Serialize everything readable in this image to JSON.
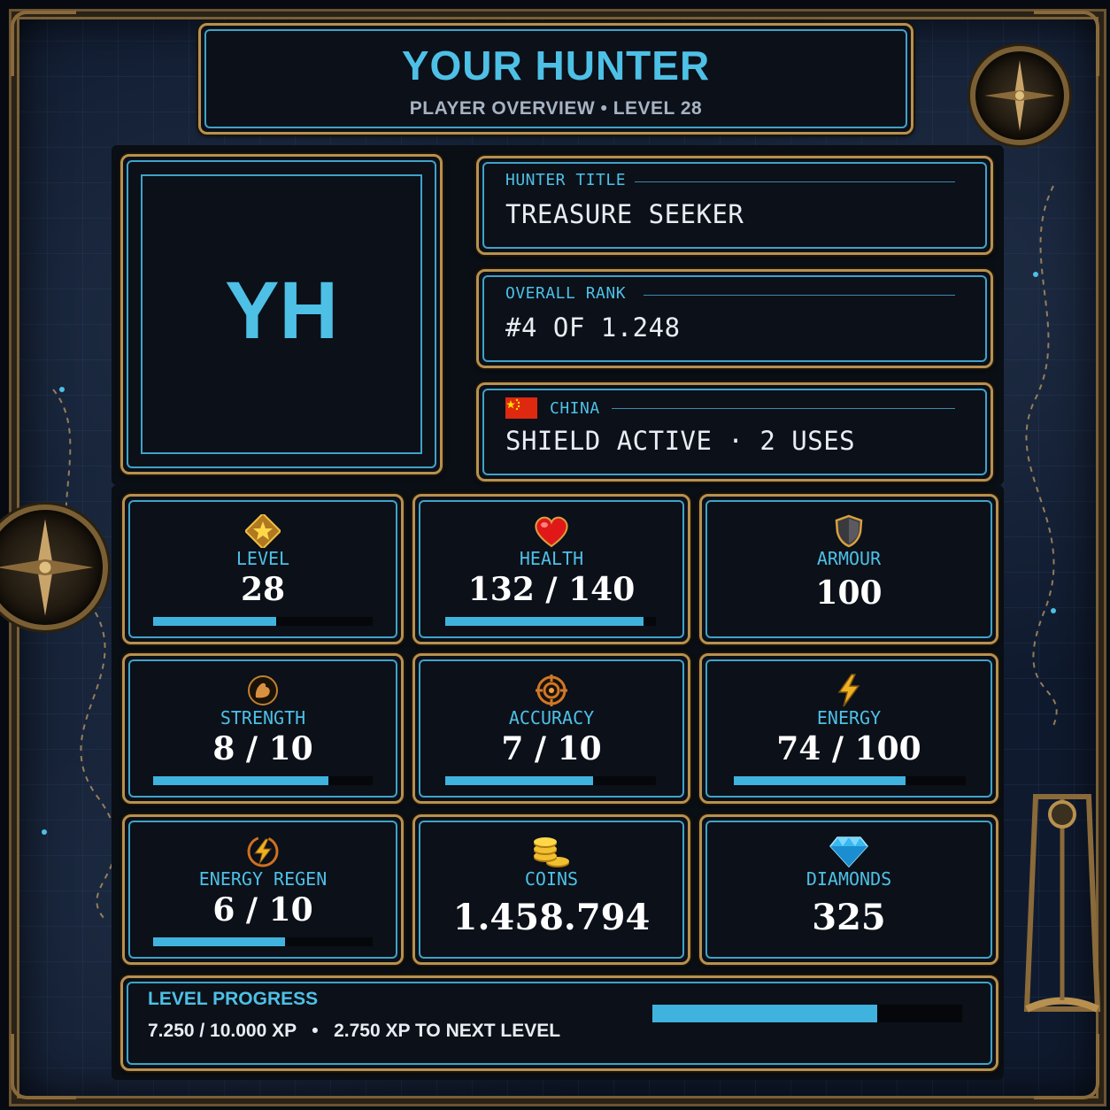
{
  "header": {
    "title": "YOUR HUNTER",
    "subtitle": "PLAYER OVERVIEW  •  LEVEL 28"
  },
  "avatar": {
    "initials": "YH"
  },
  "info": [
    {
      "label": "HUNTER TITLE",
      "value": "TREASURE SEEKER"
    },
    {
      "label": "OVERALL RANK",
      "value": "#4  OF  1.248"
    },
    {
      "label": "CHINA",
      "value": "SHIELD ACTIVE  ·  2 USES",
      "flag": "china-flag"
    }
  ],
  "stats": [
    {
      "label": "LEVEL",
      "value": "28",
      "icon": "star-icon",
      "progress": 0.56
    },
    {
      "label": "HEALTH",
      "value": "132 / 140",
      "icon": "heart-icon",
      "progress": 0.943
    },
    {
      "label": "ARMOUR",
      "value": "100",
      "icon": "shield-icon"
    },
    {
      "label": "STRENGTH",
      "value": "8 / 10",
      "icon": "muscle-icon",
      "progress": 0.8
    },
    {
      "label": "ACCURACY",
      "value": "7 / 10",
      "icon": "crosshair-icon",
      "progress": 0.7
    },
    {
      "label": "ENERGY",
      "value": "74 / 100",
      "icon": "lightning-icon",
      "progress": 0.74
    },
    {
      "label": "ENERGY REGEN",
      "value": "6 / 10",
      "icon": "energy-regen-icon",
      "progress": 0.6
    },
    {
      "label": "COINS",
      "value": "1.458.794",
      "icon": "coins-icon"
    },
    {
      "label": "DIAMONDS",
      "value": "325",
      "icon": "diamond-icon"
    }
  ],
  "level_progress": {
    "title": "LEVEL PROGRESS",
    "text": "7.250 / 10.000 XP   •   2.750 XP TO NEXT LEVEL",
    "progress": 0.725
  },
  "colors": {
    "accent": "#4ec0e6",
    "frame_gold": "#b8904f",
    "panel_bg": "#0b1019",
    "bar_fill": "#3fb3dd"
  }
}
